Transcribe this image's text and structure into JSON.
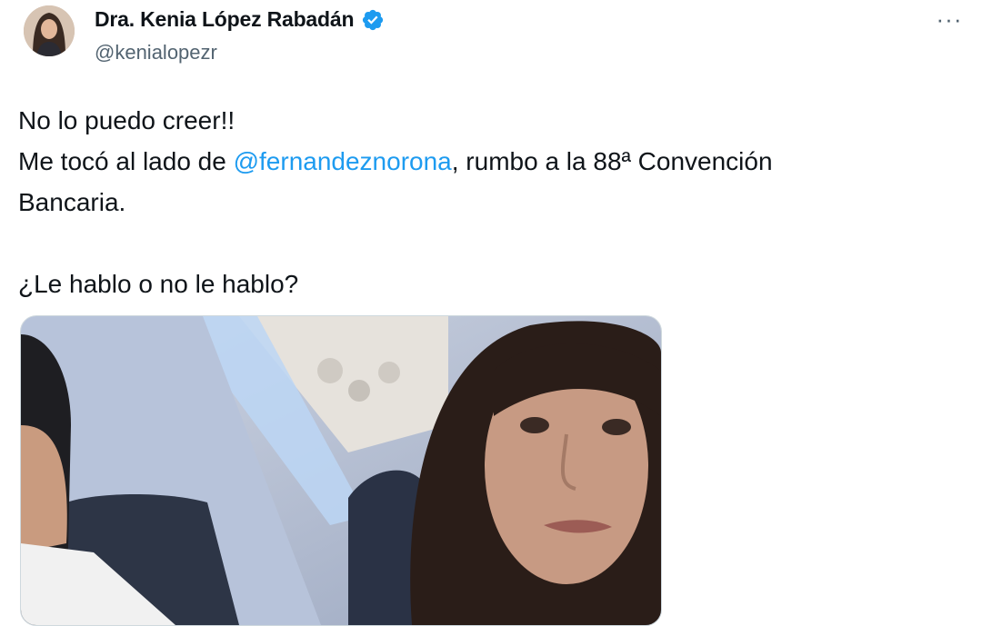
{
  "author": {
    "display_name": "Dra. Kenia López Rabadán",
    "handle": "@kenialopezr",
    "verified": true,
    "verified_color": "#1d9bf0",
    "avatar_icon": "profile-photo"
  },
  "menu": {
    "more_label": "···"
  },
  "tweet": {
    "line1": "No lo puedo creer!!",
    "line2_before": "Me tocó al lado de ",
    "mention": "@fernandeznorona",
    "line2_after": ", rumbo a la 88ª Convención",
    "line3": "Bancaria.",
    "line4": "¿Le hablo o no le hablo?",
    "mention_color": "#1d9bf0"
  },
  "media": {
    "description_icon": "airplane-selfie-photo"
  }
}
